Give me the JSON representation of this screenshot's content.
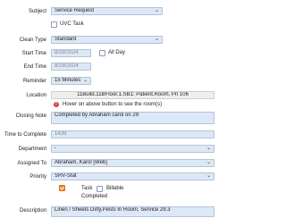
{
  "form": {
    "subject": {
      "label": "Subject",
      "value": "Service Request"
    },
    "uvc_task": {
      "label": "UVC Task",
      "checked": false
    },
    "clean_type": {
      "label": "Clean Type",
      "value": "Standard"
    },
    "start_time": {
      "label": "Start Time",
      "value": "8/29/2024"
    },
    "all_day": {
      "label": "All Day",
      "checked": false
    },
    "end_time": {
      "label": "End Time",
      "value": "8/29/2024"
    },
    "reminder": {
      "label": "Reminder",
      "value": "15 Minutes"
    },
    "location": {
      "label": "Location",
      "value": "11Build.11BFloor.1.SB1: Patient.Room, Pri 106"
    },
    "location_hint": "Hover on above button to see the room(s)",
    "closing_note": {
      "label": "Closing Note",
      "value": "Completed by Abraham carol on 29"
    },
    "time_to_complete": {
      "label": "Time to Complete",
      "value": "1439"
    },
    "department": {
      "label": "Department",
      "value": "-"
    },
    "assigned_to": {
      "label": "Assigned To",
      "value": "Abraham, Karol [Web]"
    },
    "priority": {
      "label": "Priority",
      "value": "SRV-Stat"
    },
    "task": {
      "label": "Task",
      "checked": true
    },
    "billable": {
      "label": "Billable",
      "checked": false
    },
    "completed": {
      "label": "Completed"
    },
    "description": {
      "label": "Description",
      "value": "Linen / Sheets Dirty,Pests In Room, Service 29.3"
    }
  },
  "icons": {
    "dropdown": "chevron-down-icon",
    "info": "info-icon",
    "checkbox": "checkbox-icon"
  },
  "colors": {
    "field_bg": "#dde8f6",
    "accent": "#f08a2c",
    "alert": "#e0393e"
  }
}
